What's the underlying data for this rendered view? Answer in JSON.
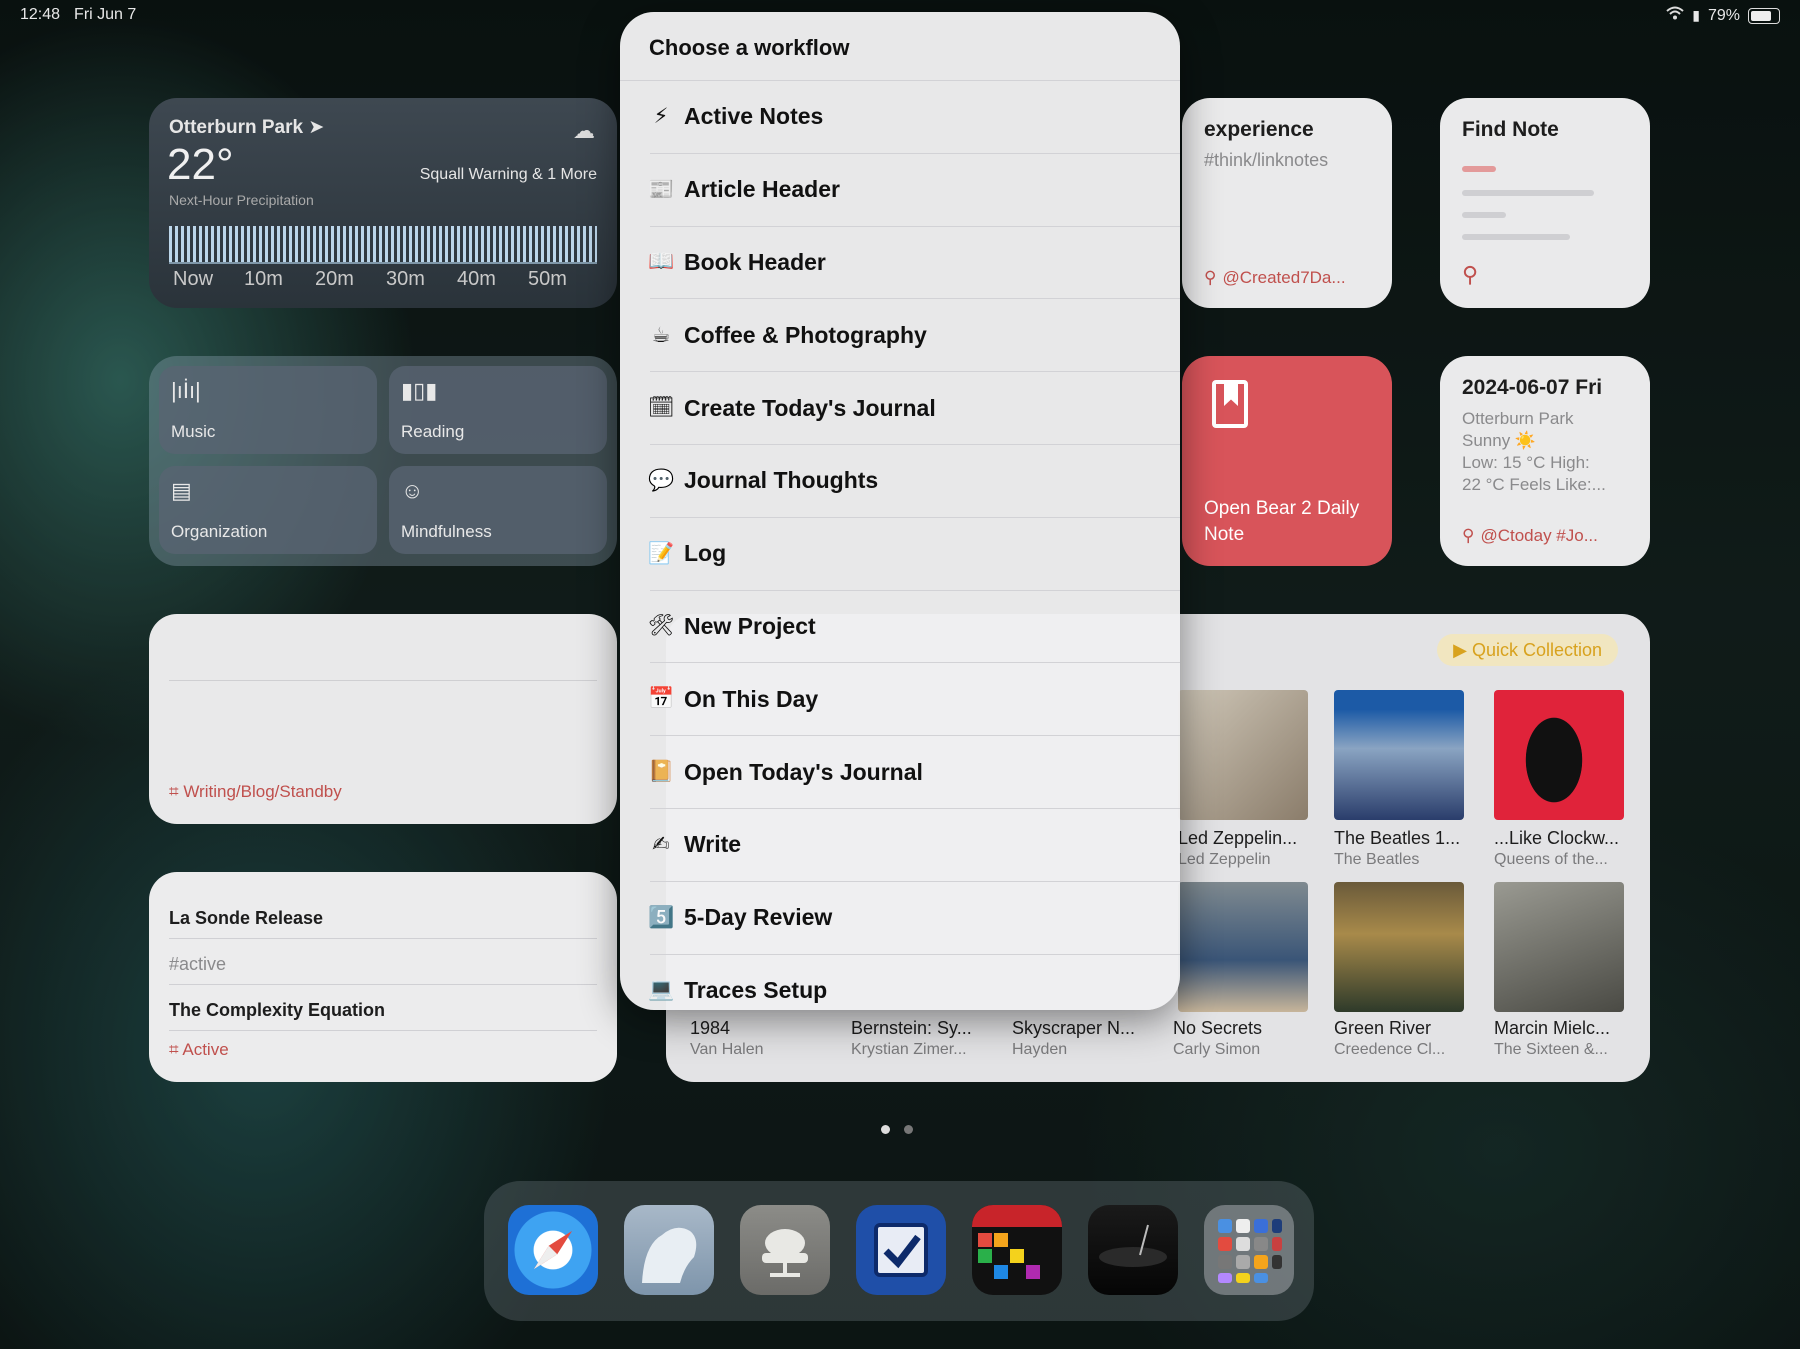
{
  "status_bar": {
    "time": "12:48",
    "date": "Fri Jun 7",
    "battery_text": "79%"
  },
  "weather": {
    "location": "Otterburn Park",
    "temperature": "22°",
    "warning": "Squall Warning & 1 More",
    "precip_label": "Next-Hour Precipitation",
    "ticks": [
      "Now",
      "10m",
      "20m",
      "30m",
      "40m",
      "50m"
    ]
  },
  "focus": {
    "tiles": [
      {
        "label": "Music",
        "icon": "waveform-icon"
      },
      {
        "label": "Reading",
        "icon": "books-icon"
      },
      {
        "label": "Organization",
        "icon": "organization-icon"
      },
      {
        "label": "Mindfulness",
        "icon": "head-icon"
      }
    ]
  },
  "standby": {
    "tag": "Writing/Blog/Standby"
  },
  "active_list": {
    "rows": [
      "La Sonde Release",
      "#active",
      "The Complexity Equation"
    ],
    "tag": "Active"
  },
  "experience": {
    "title": "experience",
    "subtitle": "#think/linknotes",
    "search": "@Created7Da..."
  },
  "find_note": {
    "title": "Find Note"
  },
  "bear": {
    "label": "Open Bear 2 Daily Note"
  },
  "daily": {
    "date": "2024-06-07 Fri",
    "lines": [
      "Otterburn Park",
      "Sunny ☀️",
      "Low: 15 °C High:",
      "22 °C Feels Like:..."
    ],
    "search": "@Ctoday #Jo..."
  },
  "music": {
    "quick_collection": "Quick Collection",
    "albums": [
      {
        "title": "Led Zeppelin...",
        "artist": "Led Zeppelin"
      },
      {
        "title": "The Beatles 1...",
        "artist": "The Beatles"
      },
      {
        "title": "...Like Clockw...",
        "artist": "Queens of the..."
      },
      {
        "title": "1984",
        "artist": "Van Halen"
      },
      {
        "title": "Bernstein: Sy...",
        "artist": "Krystian Zimer..."
      },
      {
        "title": "Skyscraper N...",
        "artist": "Hayden"
      },
      {
        "title": "No Secrets",
        "artist": "Carly Simon"
      },
      {
        "title": "Green River",
        "artist": "Creedence Cl..."
      },
      {
        "title": "Marcin Mielc...",
        "artist": "The Sixteen &..."
      }
    ]
  },
  "workflow_menu": {
    "title": "Choose a workflow",
    "items": [
      {
        "emoji": "⚡",
        "label": "Active Notes"
      },
      {
        "emoji": "📰",
        "label": "Article Header"
      },
      {
        "emoji": "📖",
        "label": "Book Header"
      },
      {
        "emoji": "☕",
        "label": "Coffee & Photography"
      },
      {
        "emoji": "🗓",
        "label": "Create Today's Journal"
      },
      {
        "emoji": "💬",
        "label": "Journal Thoughts"
      },
      {
        "emoji": "📝",
        "label": "Log"
      },
      {
        "emoji": "🛠",
        "label": "New Project"
      },
      {
        "emoji": "📅",
        "label": "On This Day"
      },
      {
        "emoji": "📔",
        "label": "Open Today's Journal"
      },
      {
        "emoji": "✍",
        "label": "Write"
      },
      {
        "emoji": "5️⃣",
        "label": "5-Day Review"
      },
      {
        "emoji": "💻",
        "label": "Traces Setup"
      }
    ]
  },
  "dock": {
    "apps": [
      "safari-icon",
      "bear-icon",
      "server-icon",
      "omnifocus-icon",
      "calendar-grid-icon",
      "turntable-icon",
      "app-library-icon"
    ]
  },
  "colors": {
    "accent_red": "#c0504d",
    "bear_red": "#d8545a",
    "quick_collection": "#d8a21e"
  }
}
